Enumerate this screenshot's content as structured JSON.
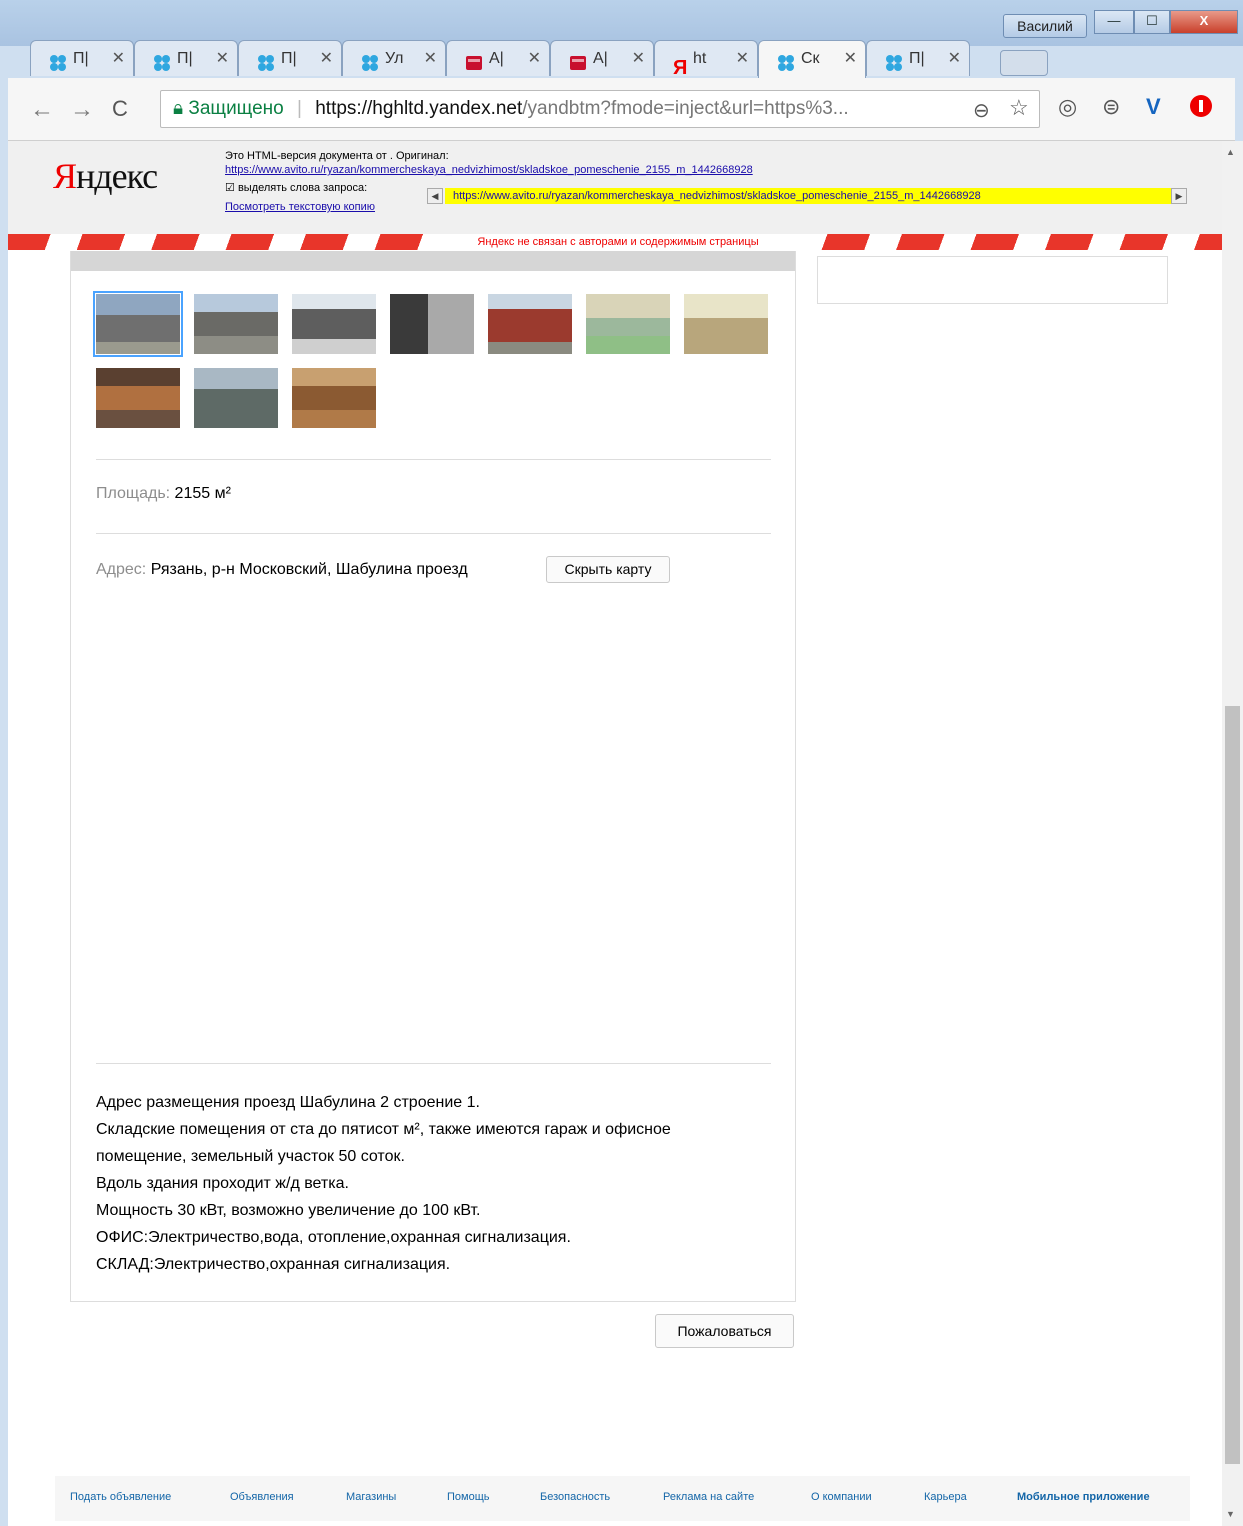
{
  "window": {
    "user": "Василий",
    "min": "—",
    "max": "☐",
    "close": "X"
  },
  "tabs": [
    {
      "label": "П|",
      "icon": "avito-icon"
    },
    {
      "label": "П|",
      "icon": "avito-icon"
    },
    {
      "label": "П|",
      "icon": "avito-icon"
    },
    {
      "label": "Ул",
      "icon": "avito-icon"
    },
    {
      "label": "А|",
      "icon": "red-app-icon"
    },
    {
      "label": "А|",
      "icon": "red-app-icon"
    },
    {
      "label": "ht",
      "icon": "yandex-icon"
    },
    {
      "label": "Ск",
      "icon": "avito-icon"
    },
    {
      "label": "П|",
      "icon": "avito-icon"
    }
  ],
  "omnibox": {
    "secure": "Защищено",
    "url_host": "https://hghltd.yandex.net",
    "url_rest": "/yandbtm?fmode=inject&url=https%3..."
  },
  "yandex": {
    "logo_first": "Я",
    "logo_rest": "ндекс",
    "info_line": "Это HTML-версия документа от . Оригинал:",
    "original_url": "https://www.avito.ru/ryazan/kommercheskaya_nedvizhimost/skladskoe_pomeschenie_2155_m_1442668928",
    "highlight_label": "выделять слова запроса:",
    "highlight_value": "https://www.avito.ru/ryazan/kommercheskaya_nedvizhimost/skladskoe_pomeschenie_2155_m_1442668928",
    "text_copy": "Посмотреть текстовую копию",
    "disclaimer": "Яндекс не связан с авторами и содержимым страницы"
  },
  "listing": {
    "area_label": "Площадь:",
    "area_value": "2155 м²",
    "address_label": "Адрес:",
    "address_value": "Рязань, р-н Московский, Шабулина проезд",
    "hide_map": "Скрыть карту",
    "description": [
      "Адрес размещения проезд Шабулина 2 строение 1.",
      "Складские помещения от ста до пятисот м², также имеются гараж и офисное",
      "помещение, земельный участок 50 соток.",
      "Вдоль здания проходит ж/д ветка.",
      "Мощность 30 кВт, возможно увеличение до 100 кВт.",
      "ОФИС:Электричество,вода, отопление,охранная сигнализация.",
      "СКЛАД:Электричество,охранная сигнализация."
    ],
    "complain": "Пожаловаться"
  },
  "footer": [
    "Подать объявление",
    "Объявления",
    "Магазины",
    "Помощь",
    "Безопасность",
    "Реклама на сайте",
    "О компании",
    "Карьера",
    "Мобильное приложение"
  ]
}
